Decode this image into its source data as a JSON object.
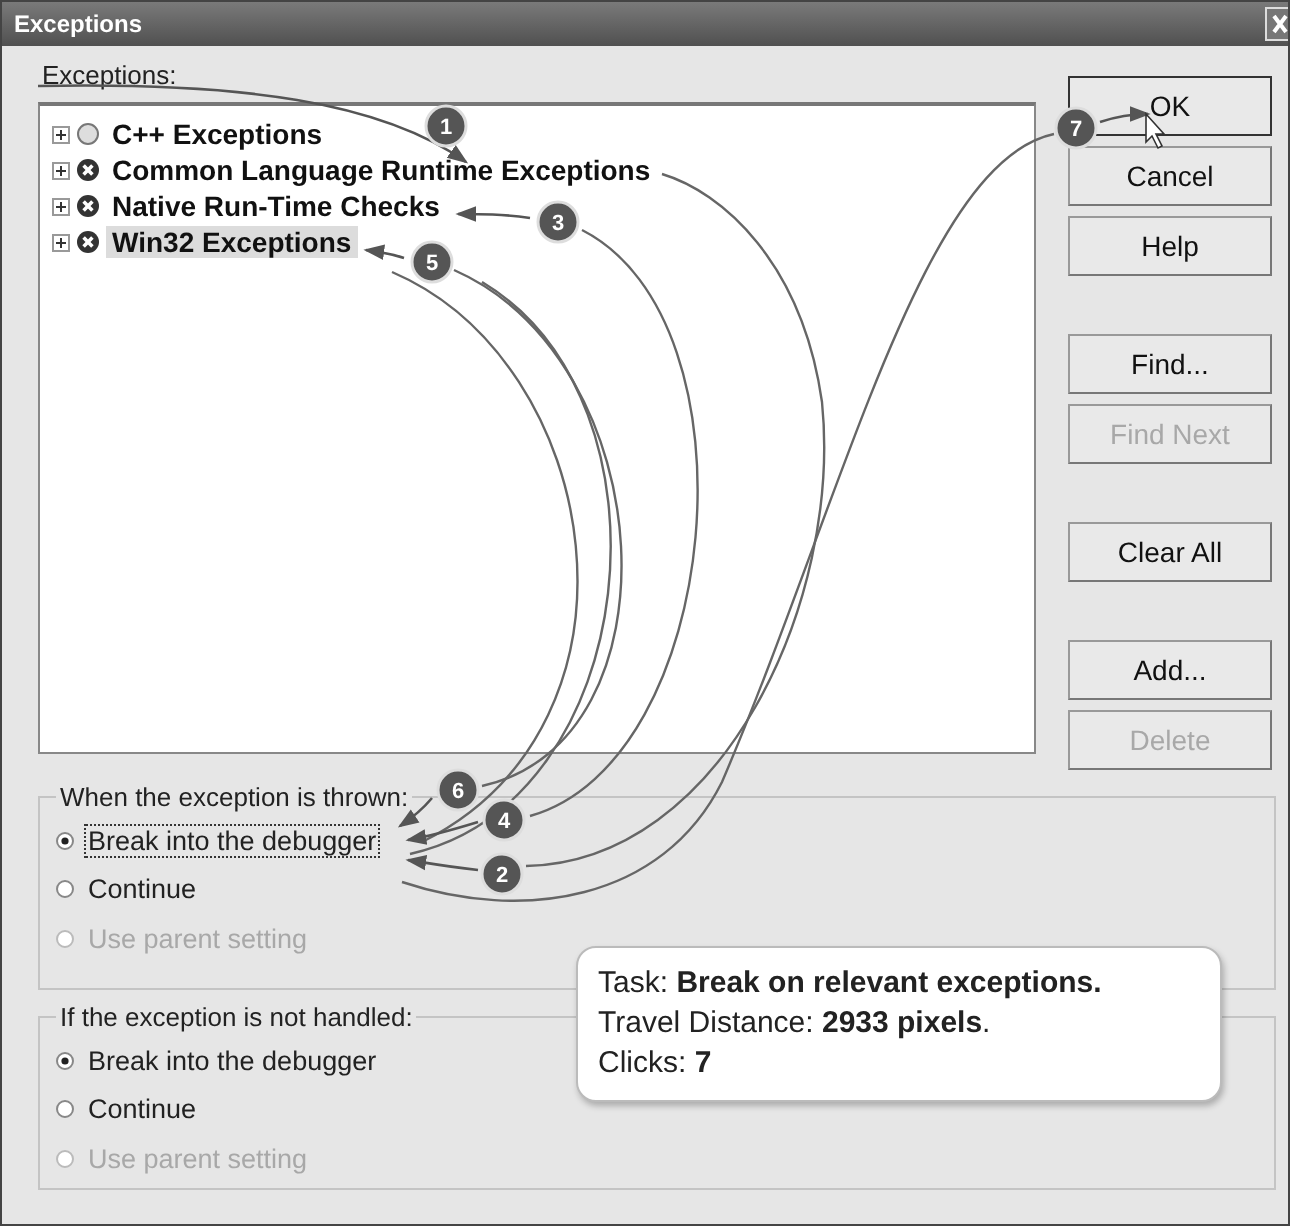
{
  "window": {
    "title": "Exceptions"
  },
  "tree": {
    "label": "Exceptions:",
    "items": [
      {
        "label": "C++ Exceptions",
        "kind": "circle",
        "selected": false
      },
      {
        "label": "Common Language Runtime Exceptions",
        "kind": "cross",
        "selected": false
      },
      {
        "label": "Native Run-Time Checks",
        "kind": "cross",
        "selected": false
      },
      {
        "label": "Win32 Exceptions",
        "kind": "cross",
        "selected": true
      }
    ]
  },
  "button_groups": [
    [
      {
        "label": "OK",
        "disabled": false
      },
      {
        "label": "Cancel",
        "disabled": false
      },
      {
        "label": "Help",
        "disabled": false
      }
    ],
    [
      {
        "label": "Find...",
        "disabled": false
      },
      {
        "label": "Find Next",
        "disabled": true
      }
    ],
    [
      {
        "label": "Clear All",
        "disabled": false
      }
    ],
    [
      {
        "label": "Add...",
        "disabled": false
      },
      {
        "label": "Delete",
        "disabled": true
      }
    ]
  ],
  "groups": [
    {
      "label": "When the exception is thrown:",
      "options": [
        {
          "label": "Break into the debugger",
          "selected": true,
          "disabled": false,
          "focused": true
        },
        {
          "label": "Continue",
          "selected": false,
          "disabled": false,
          "focused": false
        },
        {
          "label": "Use parent setting",
          "selected": false,
          "disabled": true,
          "focused": false
        }
      ]
    },
    {
      "label": "If the exception is not handled:",
      "options": [
        {
          "label": "Break into the debugger",
          "selected": true,
          "disabled": false,
          "focused": false
        },
        {
          "label": "Continue",
          "selected": false,
          "disabled": false,
          "focused": false
        },
        {
          "label": "Use parent setting",
          "selected": false,
          "disabled": true,
          "focused": false
        }
      ]
    }
  ],
  "steps": [
    "1",
    "2",
    "3",
    "4",
    "5",
    "6",
    "7"
  ],
  "info": [
    "Task: **Break on relevant exceptions.**",
    "Travel Distance: **2933 pixels**.",
    "Clicks: **7**"
  ]
}
